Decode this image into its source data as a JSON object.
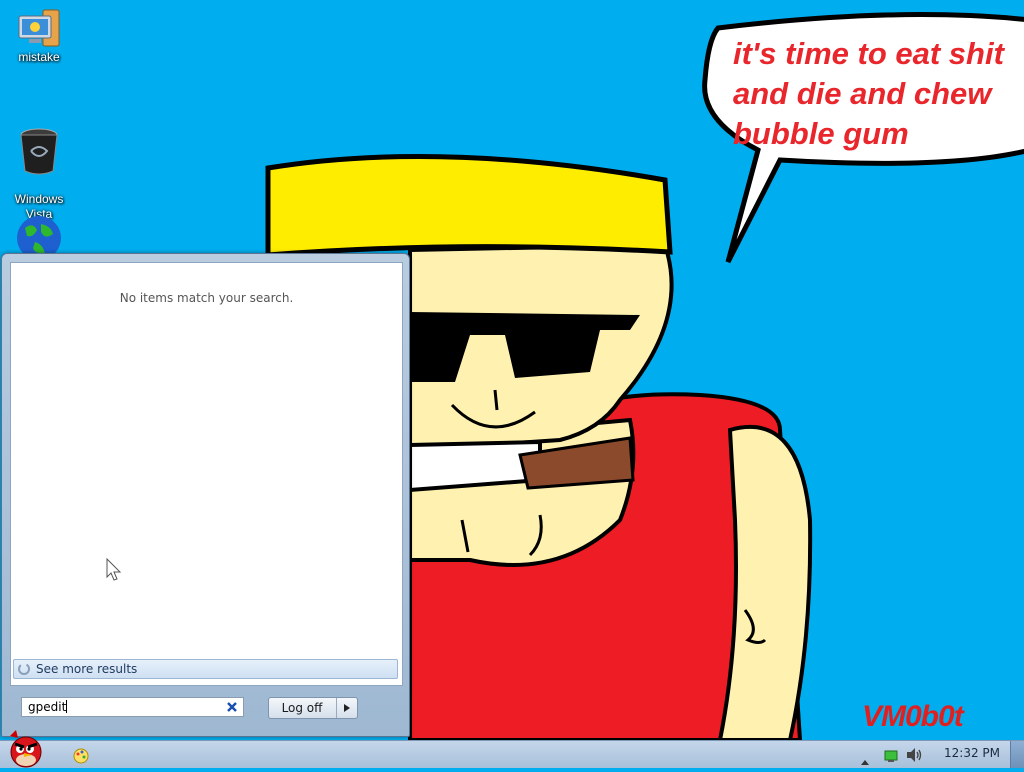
{
  "desktop": {
    "icons": [
      {
        "label": "mistake",
        "icon": "computer-icon"
      },
      {
        "label": "Windows\nVista",
        "icon": "recycle-bin-icon"
      },
      {
        "label": "",
        "icon": "globe-icon"
      }
    ]
  },
  "wallpaper": {
    "speech_text": "it's time to eat shit\nand die and chew\nbubble gum",
    "signature": "VM0b0t",
    "colors": {
      "sky": "#00aeef",
      "hat": "#ffed00",
      "skin": "#fff2b0",
      "shirt": "#ee1c24",
      "cigar": "#8b4a2b",
      "text": "#e8262b"
    }
  },
  "start_menu": {
    "no_results_text": "No items match your search.",
    "see_more_label": "See more results",
    "search_value": "gpedit",
    "logoff_label": "Log off"
  },
  "taskbar": {
    "start_icon": "angry-bird-start-icon",
    "app_icon": "paint-icon",
    "tray_icons": [
      "show-hidden-icons-chevron",
      "network-icon",
      "volume-icon"
    ],
    "clock": "12:32 PM"
  }
}
